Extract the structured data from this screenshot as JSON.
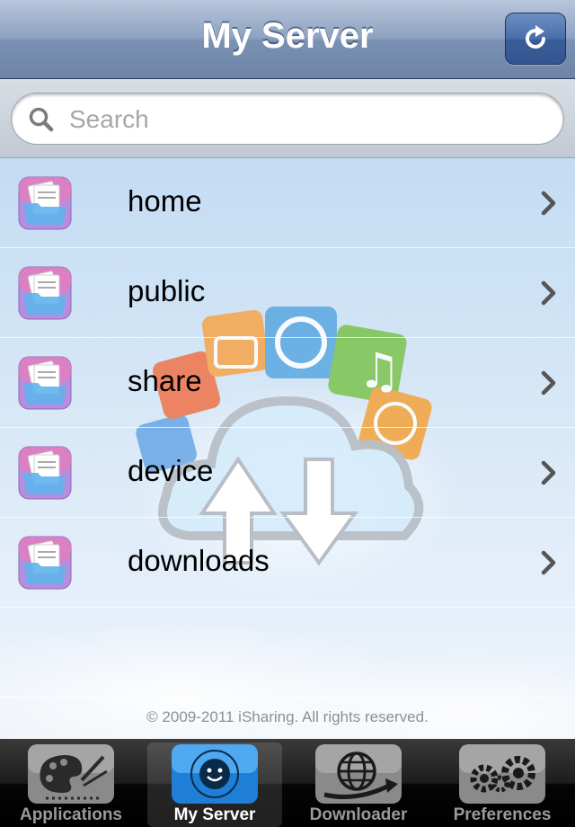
{
  "navbar": {
    "title": "My Server",
    "refresh_icon": "refresh-icon"
  },
  "search": {
    "placeholder": "Search",
    "value": ""
  },
  "folders": [
    {
      "label": "home"
    },
    {
      "label": "public"
    },
    {
      "label": "share"
    },
    {
      "label": "device"
    },
    {
      "label": "downloads"
    }
  ],
  "footer": {
    "copyright": "© 2009-2011 iSharing. All rights reserved."
  },
  "tabs": [
    {
      "label": "Applications",
      "icon": "palette-icon",
      "selected": false
    },
    {
      "label": "My Server",
      "icon": "network-attached-smiley-icon",
      "selected": true
    },
    {
      "label": "Downloader",
      "icon": "globe-icon",
      "selected": false
    },
    {
      "label": "Preferences",
      "icon": "gears-icon",
      "selected": false
    }
  ],
  "colors": {
    "navbar": "#8ea3c1",
    "refresh_button": "#4a6ea9",
    "tabbar": "#1c1c1c",
    "accent_selected_tab": "#2b8de0"
  }
}
